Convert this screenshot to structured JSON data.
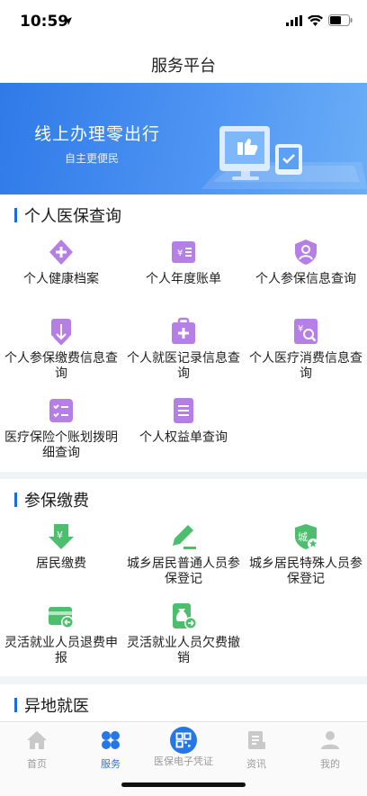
{
  "status_bar": {
    "time": "10:59"
  },
  "nav": {
    "title": "服务平台"
  },
  "banner": {
    "title": "线上办理零出行",
    "subtitle": "自主更便民"
  },
  "sections": {
    "personal": {
      "title": "个人医保查询",
      "items": [
        {
          "label": "个人健康档案",
          "icon": "health-record-icon",
          "color": "#b67fe6"
        },
        {
          "label": "个人年度账单",
          "icon": "annual-bill-icon",
          "color": "#b67fe6"
        },
        {
          "label": "个人参保信息查询",
          "icon": "insured-person-icon",
          "color": "#b67fe6"
        },
        {
          "label": "个人参保缴费信息查询",
          "icon": "payment-info-icon",
          "color": "#b67fe6"
        },
        {
          "label": "个人就医记录信息查询",
          "icon": "medical-record-icon",
          "color": "#b67fe6"
        },
        {
          "label": "个人医疗消费信息查询",
          "icon": "consumption-icon",
          "color": "#b67fe6"
        },
        {
          "label": "医疗保险个账划拨明细查询",
          "icon": "account-transfer-icon",
          "color": "#b67fe6"
        },
        {
          "label": "个人权益单查询",
          "icon": "rights-doc-icon",
          "color": "#b67fe6"
        }
      ]
    },
    "payment": {
      "title": "参保缴费",
      "items": [
        {
          "label": "居民缴费",
          "icon": "resident-payment-icon",
          "color": "#4cbe6e"
        },
        {
          "label": "城乡居民普通人员参保登记",
          "icon": "edit-register-icon",
          "color": "#4cbe6e"
        },
        {
          "label": "城乡居民特殊人员参保登记",
          "icon": "special-register-icon",
          "color": "#4cbe6e"
        },
        {
          "label": "灵活就业人员退费申报",
          "icon": "refund-card-icon",
          "color": "#4cbe6e"
        },
        {
          "label": "灵活就业人员欠费撤销",
          "icon": "arrears-cancel-icon",
          "color": "#4cbe6e"
        }
      ]
    },
    "remote": {
      "title": "异地就医"
    }
  },
  "tabs": [
    {
      "label": "首页",
      "icon": "home-icon"
    },
    {
      "label": "服务",
      "icon": "service-icon",
      "active": true
    },
    {
      "label": "医保电子凭证",
      "icon": "qr-code-icon"
    },
    {
      "label": "资讯",
      "icon": "news-icon"
    },
    {
      "label": "我的",
      "icon": "profile-icon"
    }
  ],
  "colors": {
    "accent": "#2677e6",
    "purple": "#b67fe6",
    "green": "#4cbe6e"
  }
}
